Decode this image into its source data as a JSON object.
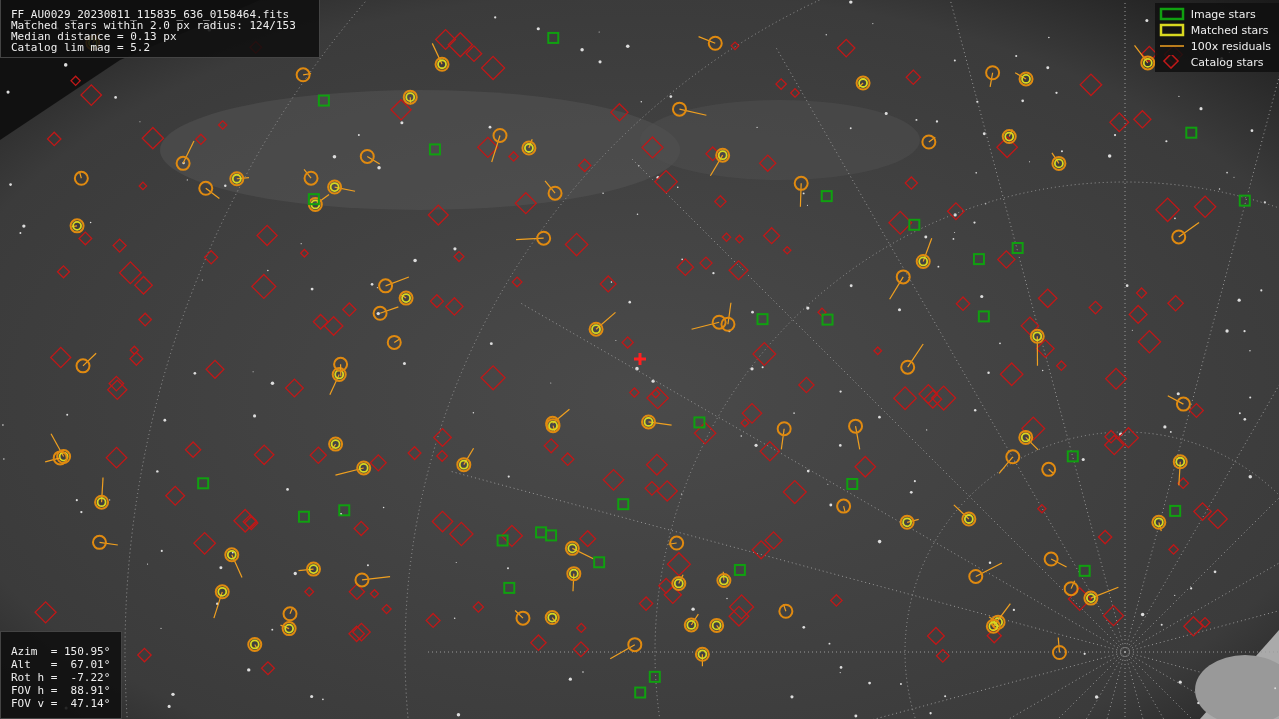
{
  "info": {
    "lines": [
      "FF_AU0029_20230811_115835_636_0158464.fits",
      "Matched stars within 2.0 px radius: 124/153",
      "Median distance = 0.13 px",
      "Catalog lim mag = 5.2"
    ]
  },
  "legend": [
    {
      "label": "Image stars"
    },
    {
      "kind": "matched",
      "label": "Matched stars"
    },
    {
      "kind": "residual",
      "label": "100x residuals"
    },
    {
      "kind": "catalog",
      "label": "Catalog stars"
    }
  ],
  "pointing": {
    "lines": [
      "Azim  = 150.95°",
      "Alt   =  67.01°",
      "Rot h =  -7.22°",
      "FOV h =  88.91°",
      "FOV v =  47.14°"
    ]
  }
}
